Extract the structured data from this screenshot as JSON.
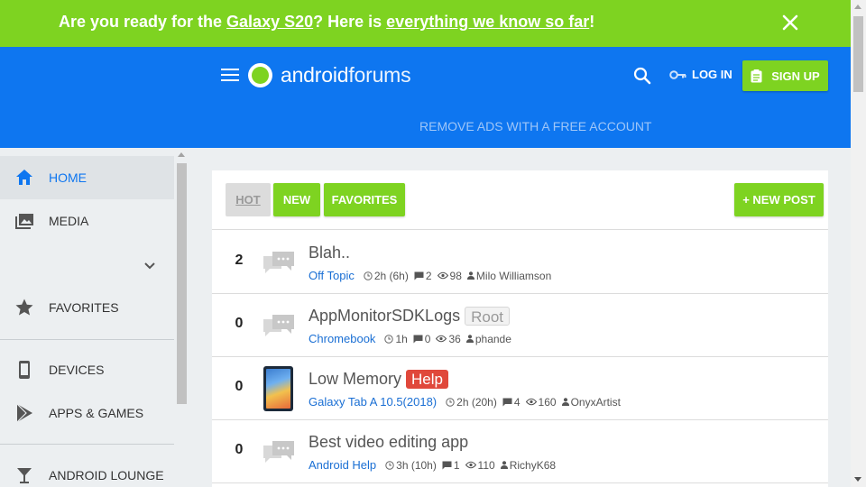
{
  "promo": {
    "text_1": "Are you ready for the ",
    "link_1": "Galaxy S20",
    "text_2": "? Here is ",
    "link_2": "everything we know so far",
    "text_3": "!",
    "close_icon": "close-icon",
    "background": "#7ed321"
  },
  "header": {
    "menu_icon": "hamburger-icon",
    "logo_word_bold": "android",
    "logo_word_light": "forums",
    "search_icon": "search-icon",
    "login_label": "LOG IN",
    "signup_label": "SIGN UP",
    "remove_ads": "REMOVE ADS WITH A FREE ACCOUNT",
    "background": "#0e76f0"
  },
  "sidebar": {
    "items": [
      {
        "label": "HOME",
        "icon": "home-icon",
        "active": true
      },
      {
        "label": "MEDIA",
        "icon": "media-icon",
        "active": false
      },
      {
        "label": "FAVORITES",
        "icon": "star-icon",
        "active": false
      },
      {
        "label": "DEVICES",
        "icon": "phone-icon",
        "active": false
      },
      {
        "label": "APPS & GAMES",
        "icon": "play-store-icon",
        "active": false
      },
      {
        "label": "ANDROID LOUNGE",
        "icon": "cocktail-icon",
        "active": false
      }
    ],
    "expand_icon": "chevron-down-icon"
  },
  "tabs": {
    "hot": "HOT",
    "new": "NEW",
    "favorites": "FAVORITES",
    "selected": "HOT",
    "new_post": "+ NEW POST"
  },
  "threads": [
    {
      "replies": "2",
      "title": "Blah..",
      "prefix": "",
      "forum": "Off Topic",
      "time": "2h (6h)",
      "comments": "2",
      "views": "98",
      "author": "Milo Williamson",
      "icon": "chat-bubbles-icon"
    },
    {
      "replies": "0",
      "title": "AppMonitorSDKLogs",
      "prefix": "Root",
      "forum": "Chromebook",
      "time": "1h",
      "comments": "0",
      "views": "36",
      "author": "phande",
      "icon": "chat-bubbles-icon"
    },
    {
      "replies": "0",
      "title": "Low Memory",
      "prefix": "Help",
      "forum": "Galaxy Tab A 10.5(2018)",
      "time": "2h (20h)",
      "comments": "4",
      "views": "160",
      "author": "OnyxArtist",
      "icon": "tablet-thumbnail"
    },
    {
      "replies": "0",
      "title": "Best video editing app",
      "prefix": "",
      "forum": "Android Help",
      "time": "3h (10h)",
      "comments": "1",
      "views": "110",
      "author": "RichyK68",
      "icon": "chat-bubbles-icon"
    }
  ],
  "colors": {
    "accent_green": "#7ed321",
    "brand_blue": "#0e76f0",
    "link_blue": "#1a6fd4",
    "help_red": "#e0483b"
  }
}
